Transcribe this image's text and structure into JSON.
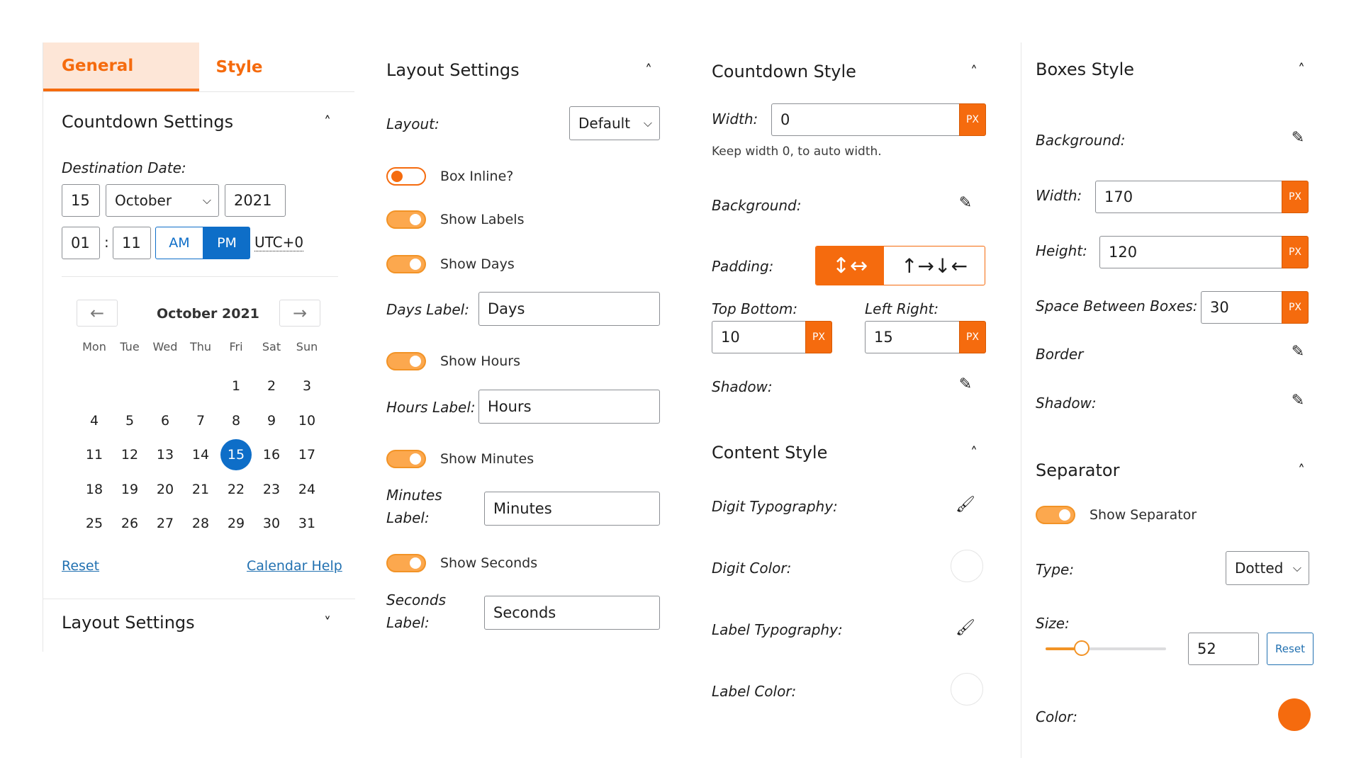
{
  "tabs": {
    "general": "General",
    "style": "Style"
  },
  "countdown_settings": {
    "title": "Countdown Settings",
    "destination_label": "Destination Date:",
    "day": "15",
    "month": "October",
    "year": "2021",
    "hour": "01",
    "separator": ":",
    "minute": "11",
    "am": "AM",
    "pm": "PM",
    "timezone": "UTC+0"
  },
  "calendar": {
    "month_label": "October 2021",
    "dow": [
      "Mon",
      "Tue",
      "Wed",
      "Thu",
      "Fri",
      "Sat",
      "Sun"
    ],
    "days": [
      "",
      "",
      "",
      "",
      "1",
      "2",
      "3",
      "4",
      "5",
      "6",
      "7",
      "8",
      "9",
      "10",
      "11",
      "12",
      "13",
      "14",
      "15",
      "16",
      "17",
      "18",
      "19",
      "20",
      "21",
      "22",
      "23",
      "24",
      "25",
      "26",
      "27",
      "28",
      "29",
      "30",
      "31"
    ],
    "selected": "15",
    "reset": "Reset",
    "help": "Calendar Help"
  },
  "layout_settings_collapsed": "Layout Settings",
  "layout_settings": {
    "title": "Layout Settings",
    "layout_label": "Layout:",
    "layout_value": "Default",
    "box_inline": "Box Inline?",
    "show_labels": "Show Labels",
    "show_days": "Show Days",
    "days_label": "Days Label:",
    "days_value": "Days",
    "show_hours": "Show Hours",
    "hours_label": "Hours Label:",
    "hours_value": "Hours",
    "show_minutes": "Show Minutes",
    "minutes_label_1": "Minutes",
    "minutes_label_2": "Label:",
    "minutes_value": "Minutes",
    "show_seconds": "Show Seconds",
    "seconds_label_1": "Seconds",
    "seconds_label_2": "Label:",
    "seconds_value": "Seconds"
  },
  "countdown_style": {
    "title": "Countdown Style",
    "width_label": "Width:",
    "width_value": "0",
    "unit": "PX",
    "help": "Keep width 0, to auto width.",
    "background_label": "Background:",
    "padding_label": "Padding:",
    "top_bottom_label": "Top Bottom:",
    "top_bottom_value": "10",
    "left_right_label": "Left Right:",
    "left_right_value": "15",
    "shadow_label": "Shadow:"
  },
  "content_style": {
    "title": "Content Style",
    "digit_typography": "Digit Typography:",
    "digit_color": "Digit Color:",
    "label_typography": "Label Typography:",
    "label_color": "Label Color:"
  },
  "boxes_style": {
    "title": "Boxes Style",
    "background_label": "Background:",
    "width_label": "Width:",
    "width_value": "170",
    "height_label": "Height:",
    "height_value": "120",
    "space_label": "Space Between Boxes:",
    "space_value": "30",
    "border_label": "Border",
    "shadow_label": "Shadow:",
    "unit": "PX"
  },
  "separator": {
    "title": "Separator",
    "show_separator": "Show Separator",
    "type_label": "Type:",
    "type_value": "Dotted",
    "size_label": "Size:",
    "size_value": "52",
    "slider_fraction": 0.3,
    "reset": "Reset",
    "color_label": "Color:",
    "color_value": "#f56b0e"
  },
  "colors": {
    "accent": "#f56b0e",
    "blue": "#0e6ec8"
  },
  "icons": {
    "collapse": "chevron-up-icon",
    "expand": "chevron-down-icon",
    "edit": "pencil-icon",
    "typography": "brush-icon"
  }
}
